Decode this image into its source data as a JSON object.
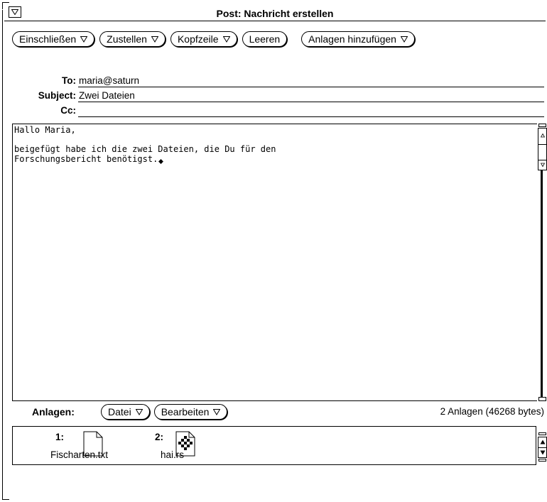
{
  "window": {
    "title": "Post: Nachricht erstellen"
  },
  "toolbar": {
    "include": "Einschließen",
    "deliver": "Zustellen",
    "header": "Kopfzeile",
    "clear": "Leeren",
    "add_attachments": "Anlagen hinzufügen"
  },
  "headers": {
    "to_label": "To:",
    "to_value": "maria@saturn",
    "subject_label": "Subject:",
    "subject_value": "Zwei Dateien",
    "cc_label": "Cc:",
    "cc_value": ""
  },
  "message": {
    "line1": "Hallo Maria,",
    "line2": "",
    "line3": "beigefügt habe ich die zwei Dateien, die Du für den",
    "line4": "Forschungsbericht benötigst."
  },
  "attachments_bar": {
    "label": "Anlagen:",
    "file_menu": "Datei",
    "edit_menu": "Bearbeiten",
    "summary": "2 Anlagen (46268 bytes)"
  },
  "attachments": [
    {
      "index": "1:",
      "name": "Fischarten.txt",
      "icon": "document-icon"
    },
    {
      "index": "2:",
      "name": "hai.rs",
      "icon": "raster-image-icon"
    }
  ]
}
